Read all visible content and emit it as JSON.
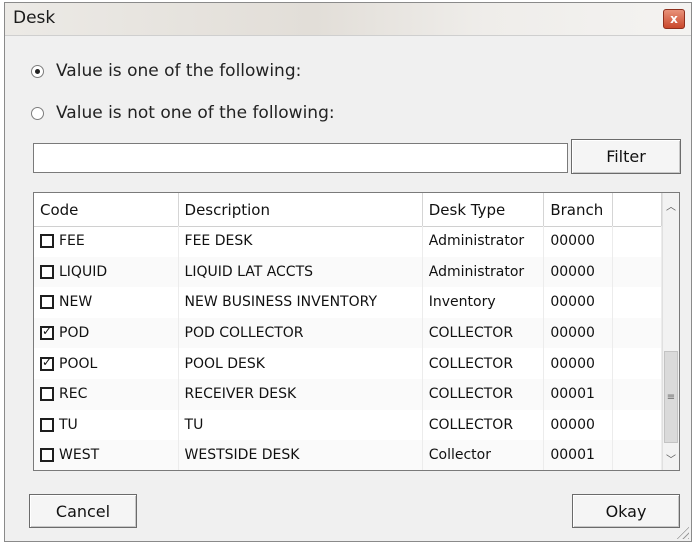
{
  "window": {
    "title": "Desk",
    "close_glyph": "x"
  },
  "radio_options": [
    {
      "label": "Value is one of the following:",
      "checked": true
    },
    {
      "label": "Value is not one of the following:",
      "checked": false
    }
  ],
  "filter": {
    "value": "",
    "button_label": "Filter"
  },
  "table": {
    "headers": [
      "Code",
      "Description",
      "Desk Type",
      "Branch"
    ],
    "rows": [
      {
        "code": "FEE",
        "description": "FEE DESK",
        "desk_type": "Administrator",
        "branch": "00000",
        "checked": false
      },
      {
        "code": "LIQUID",
        "description": "LIQUID LAT ACCTS",
        "desk_type": "Administrator",
        "branch": "00000",
        "checked": false
      },
      {
        "code": "NEW",
        "description": "NEW BUSINESS INVENTORY",
        "desk_type": "Inventory",
        "branch": "00000",
        "checked": false
      },
      {
        "code": "POD",
        "description": "POD COLLECTOR",
        "desk_type": "COLLECTOR",
        "branch": "00000",
        "checked": true
      },
      {
        "code": "POOL",
        "description": "POOL DESK",
        "desk_type": "COLLECTOR",
        "branch": "00000",
        "checked": true
      },
      {
        "code": "REC",
        "description": "RECEIVER DESK",
        "desk_type": "COLLECTOR",
        "branch": "00001",
        "checked": false
      },
      {
        "code": "TU",
        "description": "TU",
        "desk_type": "COLLECTOR",
        "branch": "00000",
        "checked": false
      },
      {
        "code": "WEST",
        "description": "WESTSIDE DESK",
        "desk_type": "Collector",
        "branch": "00001",
        "checked": false
      }
    ]
  },
  "buttons": {
    "cancel_label": "Cancel",
    "okay_label": "Okay"
  },
  "icons": {
    "close": "close-icon",
    "scroll_up": "chevron-up-icon",
    "scroll_down": "chevron-down-icon",
    "thumb_grip": "grip-lines-icon",
    "resize": "resize-grip-icon"
  }
}
